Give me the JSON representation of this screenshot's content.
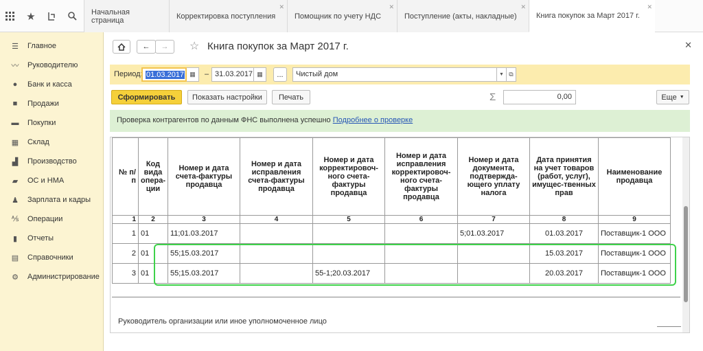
{
  "topbar": {
    "icons": [
      "grid-icon",
      "star-icon",
      "history-icon",
      "search-icon"
    ],
    "tabs": [
      {
        "label": "Начальная страница"
      },
      {
        "label": "Корректировка поступления"
      },
      {
        "label": "Помощник по учету НДС"
      },
      {
        "label": "Поступление (акты, накладные)"
      },
      {
        "label": "Книга покупок за Март 2017 г."
      }
    ]
  },
  "sidebar": {
    "items": [
      {
        "label": "Главное",
        "icon": "menu-icon"
      },
      {
        "label": "Руководителю",
        "icon": "trend-icon"
      },
      {
        "label": "Банк и касса",
        "icon": "ruble-icon"
      },
      {
        "label": "Продажи",
        "icon": "bag-icon"
      },
      {
        "label": "Покупки",
        "icon": "cart-icon"
      },
      {
        "label": "Склад",
        "icon": "warehouse-icon"
      },
      {
        "label": "Производство",
        "icon": "factory-icon"
      },
      {
        "label": "ОС и НМА",
        "icon": "truck-icon"
      },
      {
        "label": "Зарплата и кадры",
        "icon": "person-icon"
      },
      {
        "label": "Операции",
        "icon": "operations-icon"
      },
      {
        "label": "Отчеты",
        "icon": "chart-icon"
      },
      {
        "label": "Справочники",
        "icon": "books-icon"
      },
      {
        "label": "Администрирование",
        "icon": "gear-icon"
      }
    ]
  },
  "window": {
    "title": "Книга покупок за Март 2017 г."
  },
  "period": {
    "label": "Период:",
    "from": "01.03.2017",
    "dash": "–",
    "to": "31.03.2017",
    "ellipsis": "...",
    "organization": "Чистый дом"
  },
  "toolbar": {
    "generate": "Сформировать",
    "settings": "Показать настройки",
    "print": "Печать",
    "sigma": "Σ",
    "sum": "0,00",
    "more": "Еще"
  },
  "info": {
    "text": "Проверка контрагентов по данным ФНС выполнена успешно",
    "link": "Подробнее о проверке"
  },
  "report": {
    "headers": [
      "№ п/п",
      "Код вида опера-ции",
      "Номер и дата счета-фактуры продавца",
      "Номер и дата исправления счета-фактуры продавца",
      "Номер и дата корректировоч-ного счета-фактуры продавца",
      "Номер и дата исправления корректировоч-ного счета-фактуры продавца",
      "Номер и дата документа, подтвержда-ющего уплату налога",
      "Дата принятия на учет товаров (работ, услуг), имущес-твенных прав",
      "Наименование продавца"
    ],
    "numbers": [
      "1",
      "2",
      "3",
      "4",
      "5",
      "6",
      "7",
      "8",
      "9"
    ],
    "rows": [
      [
        "1",
        "01",
        "11;01.03.2017",
        "",
        "",
        "",
        "5;01.03.2017",
        "01.03.2017",
        "Поставщик-1 ООО"
      ],
      [
        "2",
        "01",
        "55;15.03.2017",
        "",
        "",
        "",
        "",
        "15.03.2017",
        "Поставщик-1 ООО"
      ],
      [
        "3",
        "01",
        "55;15.03.2017",
        "",
        "55-1;20.03.2017",
        "",
        "",
        "20.03.2017",
        "Поставщик-1 ООО"
      ]
    ],
    "footer": "Руководитель организации или иное уполномоченное лицо"
  }
}
